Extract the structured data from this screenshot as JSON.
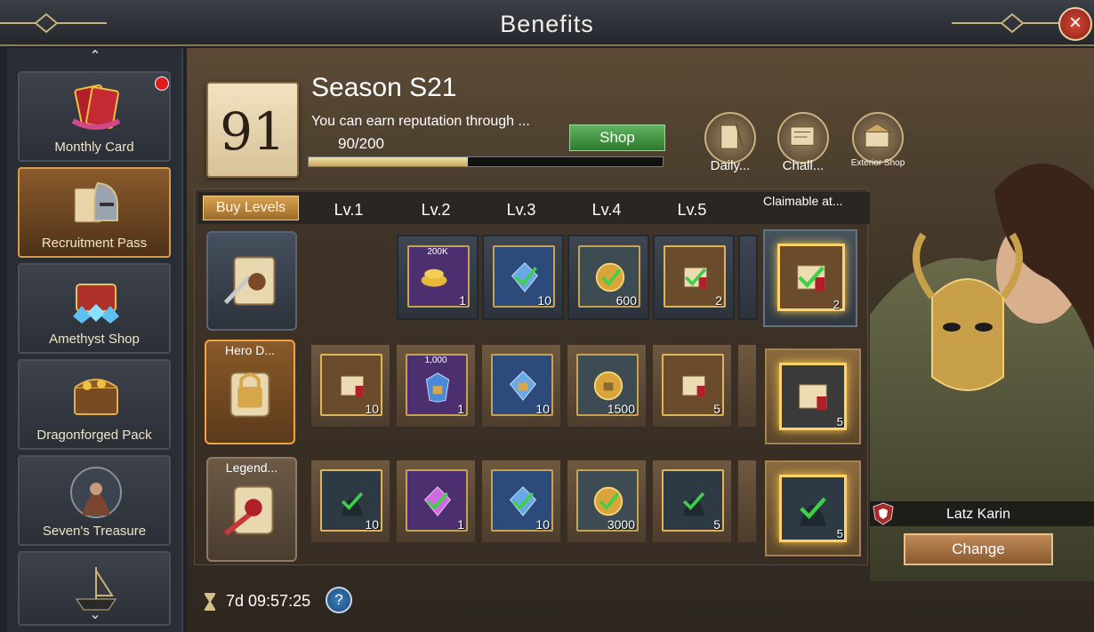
{
  "window": {
    "title": "Benefits",
    "close_symbol": "×",
    "colors": {
      "gold": "#d6a64a",
      "green": "#3c9a3c",
      "brown": "#7a5a3a"
    }
  },
  "sidebar": {
    "up_symbol": "⌃",
    "down_symbol": "⌄",
    "items": [
      {
        "label": "Monthly Card",
        "icon": "monthly-card-icon",
        "badge": true
      },
      {
        "label": "Recruitment Pass",
        "icon": "helmet-scroll-icon",
        "active": true
      },
      {
        "label": "Amethyst Shop",
        "icon": "chest-gems-icon"
      },
      {
        "label": "Dragonforged Pack",
        "icon": "treasure-chest-icon"
      },
      {
        "label": "Seven's Treasure",
        "icon": "monk-icon"
      },
      {
        "label": "",
        "icon": "ship-icon"
      }
    ]
  },
  "season": {
    "level": "91",
    "title": "Season S21",
    "description": "You can earn reputation through ...",
    "progress_text": "90/200",
    "progress": 0.45,
    "shop_label": "Shop",
    "actions": [
      {
        "label": "Daily...",
        "icon": "scroll-quill-icon"
      },
      {
        "label": "Chall...",
        "icon": "map-scroll-icon"
      },
      {
        "label": "Exterior Shop",
        "icon": "shop-icon"
      }
    ]
  },
  "grid": {
    "buy_levels_label": "Buy Levels",
    "levels": [
      "Lv.1",
      "Lv.2",
      "Lv.3",
      "Lv.4",
      "Lv.5"
    ],
    "claimable_label": "Claimable at...",
    "rows": [
      {
        "label": "",
        "icon": "scroll-feather-icon",
        "cells": [
          {
            "qty": "1",
            "tag": "200K",
            "style": "purple",
            "icon": "gold-coins-icon"
          },
          {
            "qty": "10",
            "tag": "",
            "style": "blue",
            "icon": "blue-crystal-icon"
          },
          {
            "qty": "600",
            "tag": "",
            "style": "gray",
            "icon": "gold-medal-icon"
          },
          {
            "qty": "2",
            "tag": "",
            "style": "gold",
            "icon": "red-scroll-icon"
          }
        ],
        "claim": {
          "qty": "2",
          "icon": "red-scroll-icon"
        }
      },
      {
        "label": "Hero D...",
        "icon": "lock-scroll-icon",
        "cells": [
          {
            "qty": "10",
            "tag": "",
            "style": "gold",
            "icon": "red-scroll-icon"
          },
          {
            "qty": "1",
            "tag": "1,000",
            "style": "purple",
            "icon": "blue-shield-lock-icon"
          },
          {
            "qty": "10",
            "tag": "",
            "style": "blue",
            "icon": "blue-lock-icon"
          },
          {
            "qty": "1500",
            "tag": "",
            "style": "gray",
            "icon": "gold-lock-coin-icon"
          },
          {
            "qty": "5",
            "tag": "",
            "style": "gold",
            "icon": "red-scroll-icon"
          }
        ],
        "claim": {
          "qty": "5",
          "icon": "red-scroll-icon"
        }
      },
      {
        "label": "Legend...",
        "icon": "legend-scroll-icon",
        "cells": [
          {
            "qty": "10",
            "tag": "",
            "style": "gold",
            "icon": "hooded-hero-icon"
          },
          {
            "qty": "1",
            "tag": "",
            "style": "purple",
            "icon": "purple-crystal-icon"
          },
          {
            "qty": "10",
            "tag": "",
            "style": "blue",
            "icon": "blue-crystal-icon"
          },
          {
            "qty": "3000",
            "tag": "",
            "style": "gray",
            "icon": "gold-medal-icon"
          },
          {
            "qty": "5",
            "tag": "",
            "style": "gold",
            "icon": "hooded-hero-icon"
          }
        ],
        "claim": {
          "qty": "5",
          "icon": "hooded-hero-icon"
        }
      }
    ]
  },
  "hero": {
    "name": "Latz Karin",
    "change_label": "Change"
  },
  "footer": {
    "timer": "7d 09:57:25",
    "help_symbol": "?"
  }
}
